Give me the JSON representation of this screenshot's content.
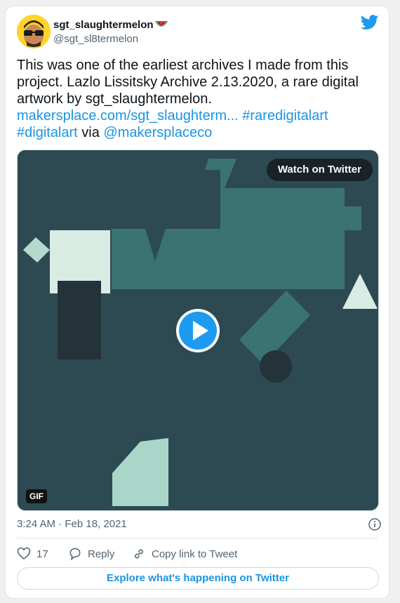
{
  "tweet": {
    "author_name": "sgt_slaughtermelon",
    "author_handle": "@sgt_sl8termelon",
    "text_plain_1": "This was one of the earliest archives I made from this project. Lazlo Lissitsky Archive 2.13.2020, a rare digital artwork by sgt_slaughtermelon.",
    "link_url": "makersplace.com/sgt_slaughterm...",
    "hashtag_1": "#raredigitalart",
    "hashtag_2": "#digitalart",
    "text_via": "via",
    "mention": "@makersplaceco",
    "timestamp": "3:24 AM · Feb 18, 2021"
  },
  "media": {
    "watch_label": "Watch on Twitter",
    "gif_badge": "GIF",
    "background_color": "#2d4a52"
  },
  "actions": {
    "like_count": "17",
    "reply_label": "Reply",
    "copy_label": "Copy link to Tweet",
    "explore_label": "Explore what's happening on Twitter"
  },
  "colors": {
    "link": "#1b95e0",
    "twitter_blue": "#1d9bf0",
    "text": "#0f1419",
    "muted": "#536471"
  }
}
